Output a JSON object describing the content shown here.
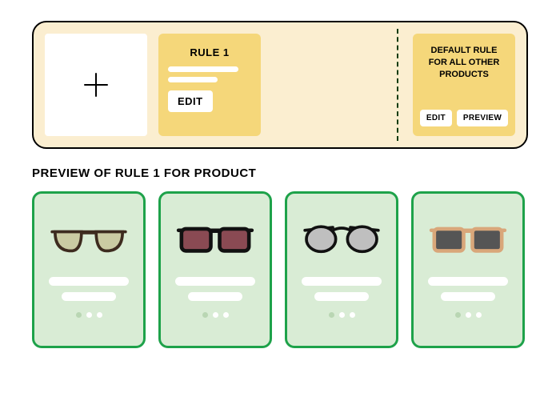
{
  "rules": {
    "rule1": {
      "title": "RULE 1",
      "edit_label": "EDIT"
    },
    "default": {
      "title": "DEFAULT RULE FOR ALL OTHER PRODUCTS",
      "edit_label": "EDIT",
      "preview_label": "PREVIEW"
    }
  },
  "preview_heading": "PREVIEW OF RULE 1 FOR PRODUCT",
  "products": [
    {
      "id": "sunglasses-1"
    },
    {
      "id": "sunglasses-2"
    },
    {
      "id": "sunglasses-3"
    },
    {
      "id": "sunglasses-4"
    }
  ]
}
